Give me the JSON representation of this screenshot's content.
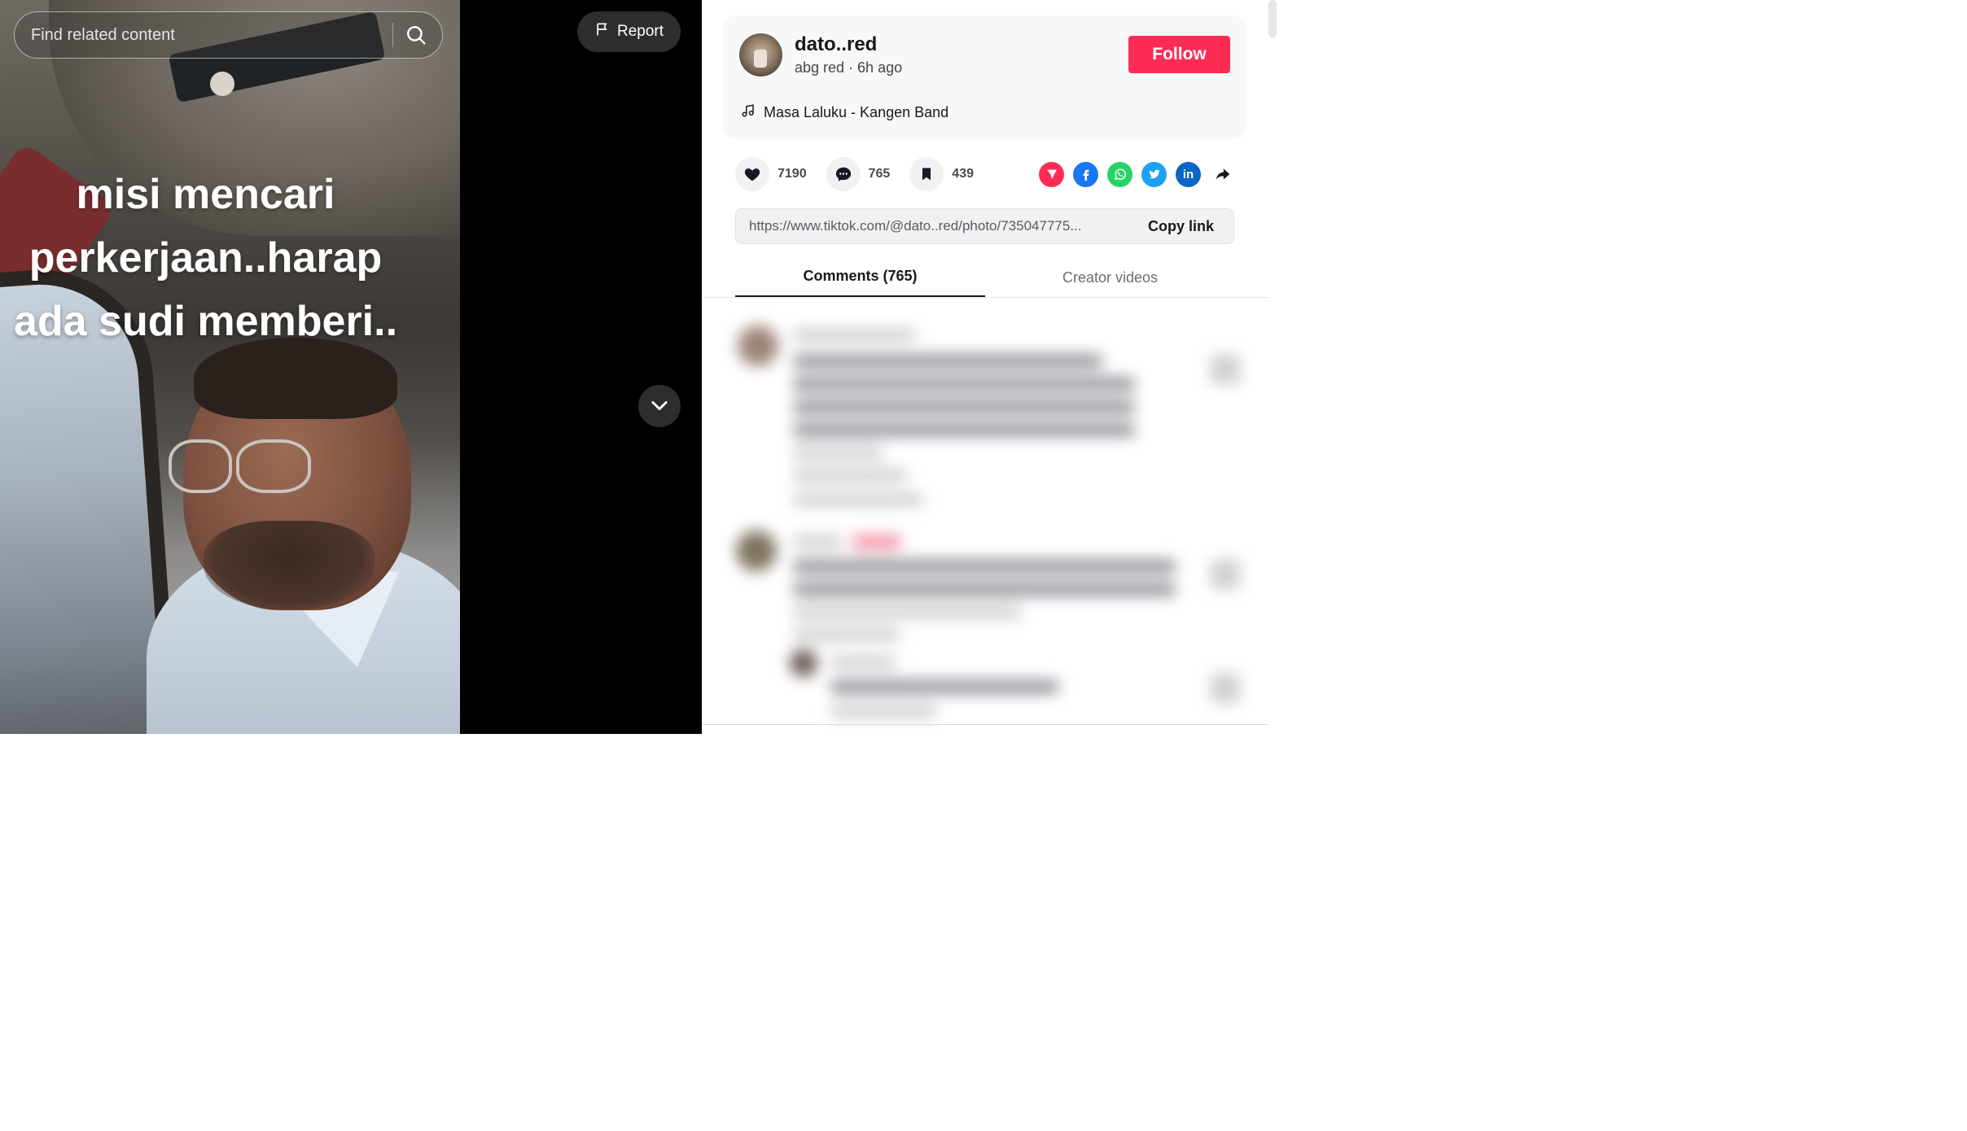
{
  "media": {
    "caption_lines": [
      "misi mencari",
      "perkerjaan..harap",
      "ada sudi memberi.."
    ],
    "search_placeholder": "Find related content",
    "report_label": "Report"
  },
  "post": {
    "username": "dato..red",
    "subline": "abg red · 6h ago",
    "follow_label": "Follow",
    "music": "Masa Laluku - Kangen Band"
  },
  "stats": {
    "likes": "7190",
    "comments": "765",
    "saves": "439"
  },
  "share": {
    "icons": [
      "send-to-friends-icon",
      "facebook-icon",
      "whatsapp-icon",
      "twitter-icon",
      "linkedin-icon",
      "share-arrow-icon"
    ],
    "colors": {
      "send": "#fe2c55",
      "facebook": "#1877f2",
      "whatsapp": "#25d366",
      "twitter": "#1da1f2",
      "linkedin": "#0a66c2"
    }
  },
  "link": {
    "url": "https://www.tiktok.com/@dato..red/photo/735047775...",
    "copy_label": "Copy link"
  },
  "tabs": [
    {
      "label": "Comments (765)",
      "active": true
    },
    {
      "label": "Creator videos",
      "active": false
    }
  ],
  "colors": {
    "accent": "#fe2c55",
    "text": "#161823"
  }
}
